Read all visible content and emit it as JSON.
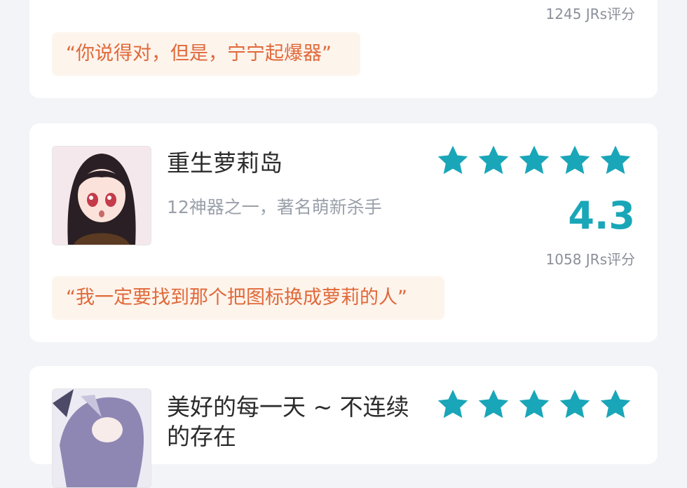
{
  "colors": {
    "accent": "#19a6b8",
    "quote_text": "#e0693a",
    "quote_bg": "#fdf4ec",
    "background": "#f3f4f7"
  },
  "cards": [
    {
      "rating_count": "1245 JRs评分",
      "quote": "“你说得对，但是，宁宁起爆器”"
    },
    {
      "title": "重生萝莉岛",
      "subtitle": "12神器之一，著名萌新杀手",
      "stars": 5,
      "score": "4.3",
      "rating_count": "1058 JRs评分",
      "quote": "“我一定要找到那个把图标换成萝莉的人”",
      "icon": "anime-girl-avatar"
    },
    {
      "title_line1": "美好的每一天 ~ 不连续",
      "title_line2": "的存在",
      "stars": 5,
      "icon": "anime-girl-avatar"
    }
  ]
}
